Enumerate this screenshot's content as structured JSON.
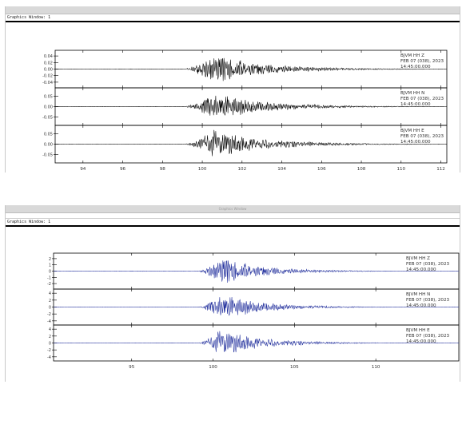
{
  "windows": [
    {
      "window_label": "Graphics Window:  1",
      "toolbar_text": "",
      "tick_color": "#000000",
      "trace_color": "#000000",
      "chart_data": {
        "type": "line",
        "x_ticks": [
          94,
          96,
          98,
          100,
          102,
          104,
          106,
          108,
          110,
          112
        ],
        "xlim": [
          92.6,
          112.3
        ],
        "event_onset": 99.1,
        "event_peak": 100.6,
        "panels": [
          {
            "station": "BJVM",
            "channel": "HH Z",
            "date": "FEB 07 (038), 2023",
            "time": "14:45:00.000",
            "yticks": [
              0.04,
              0.02,
              0.0,
              -0.02,
              -0.04
            ],
            "ytick_labels": [
              "0.04",
              "0.02",
              "0.00",
              "-0.02",
              "-0.04"
            ],
            "ylim": [
              -0.05,
              0.05
            ],
            "peak_amp": 0.046
          },
          {
            "station": "BJVM",
            "channel": "HH N",
            "date": "FEB 07 (038), 2023",
            "time": "14:45:00.000",
            "yticks": [
              0.05,
              0.0,
              -0.05
            ],
            "ytick_labels": [
              "0.05",
              "0.00",
              "-0.05"
            ],
            "ylim": [
              -0.08,
              0.08
            ],
            "peak_amp": 0.07
          },
          {
            "station": "BJVM",
            "channel": "HH E",
            "date": "FEB 07 (038), 2023",
            "time": "14:45:00.000",
            "yticks": [
              0.05,
              0.0,
              -0.05
            ],
            "ytick_labels": [
              "0.05",
              "0.00",
              "-0.05"
            ],
            "ylim": [
              -0.08,
              0.08
            ],
            "peak_amp": 0.07
          }
        ]
      }
    },
    {
      "window_label": "Graphics Window:  1",
      "toolbar_text": "Graphics Window",
      "tick_color": "#000000",
      "trace_color": "#1c2a9a",
      "chart_data": {
        "type": "line",
        "x_ticks": [
          95,
          100,
          105,
          110
        ],
        "xlim": [
          90.2,
          115.1
        ],
        "event_onset": 99.1,
        "event_peak": 100.5,
        "panels": [
          {
            "station": "BJVM",
            "channel": "HH Z",
            "date": "FEB 07 (038), 2023",
            "time": "14:45:00.000",
            "yticks": [
              2,
              1,
              0,
              -1,
              -2
            ],
            "ytick_labels": [
              "2",
              "1",
              "0",
              "-1",
              "-2"
            ],
            "ylim": [
              -2.5,
              2.5
            ],
            "peak_amp": 2.3
          },
          {
            "station": "BJVM",
            "channel": "HH N",
            "date": "FEB 07 (038), 2023",
            "time": "14:45:00.000",
            "yticks": [
              4,
              2,
              0,
              -2,
              -4
            ],
            "ytick_labels": [
              "4",
              "2",
              "0",
              "-2",
              "-4"
            ],
            "ylim": [
              -4.5,
              4.5
            ],
            "peak_amp": 4
          },
          {
            "station": "BJVM",
            "channel": "HH E",
            "date": "FEB 07 (038), 2023",
            "time": "14:45:00.000",
            "yticks": [
              4,
              2,
              0,
              -2,
              -4
            ],
            "ytick_labels": [
              "4",
              "2",
              "0",
              "-2",
              "-4"
            ],
            "ylim": [
              -4.5,
              4.5
            ],
            "peak_amp": 4
          }
        ]
      }
    }
  ]
}
